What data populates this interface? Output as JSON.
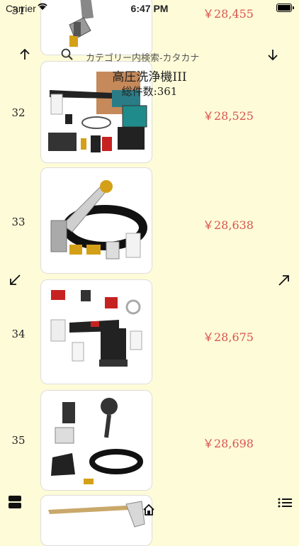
{
  "status": {
    "carrier": "Carrier",
    "time": "6:47 PM"
  },
  "search": {
    "placeholder": "カテゴリー内検索-カタカナ"
  },
  "header": {
    "title": "高圧洗浄機III",
    "count": "総件数:361"
  },
  "items": [
    {
      "num": "31",
      "price": "￥28,455"
    },
    {
      "num": "32",
      "price": "￥28,525"
    },
    {
      "num": "33",
      "price": "￥28,638"
    },
    {
      "num": "34",
      "price": "￥28,675"
    },
    {
      "num": "35",
      "price": "￥28,698"
    }
  ],
  "icons": {
    "scroll_up": "arrow-up-icon",
    "scroll_down": "arrow-down-icon",
    "collapse": "arrow-down-left-icon",
    "expand": "arrow-up-right-icon",
    "layout": "layout-icon",
    "home": "home-icon",
    "list": "list-icon"
  }
}
